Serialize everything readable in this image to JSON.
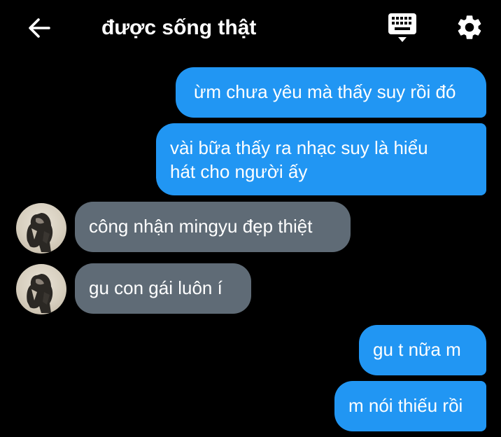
{
  "header": {
    "title": "được sống thật",
    "back_icon": "arrow-left-icon",
    "keyboard_icon": "keyboard-icon",
    "settings_icon": "gear-icon"
  },
  "messages": [
    {
      "direction": "sent",
      "text": "ừm chưa yêu mà thấy suy rồi đó"
    },
    {
      "direction": "sent",
      "lines": [
        "vài bữa thấy ra nhạc suy là hiểu",
        "hát cho người ấy"
      ]
    },
    {
      "direction": "received",
      "text": "công nhận mingyu đẹp thiệt"
    },
    {
      "direction": "received",
      "text": "gu con gái luôn í"
    },
    {
      "direction": "sent",
      "text": "gu t nữa m"
    },
    {
      "direction": "sent",
      "text": "m nói thiếu rồi"
    }
  ],
  "colors": {
    "background": "#000000",
    "sent_bubble": "#2196f3",
    "received_bubble": "#5f6b76",
    "text": "#ffffff"
  }
}
